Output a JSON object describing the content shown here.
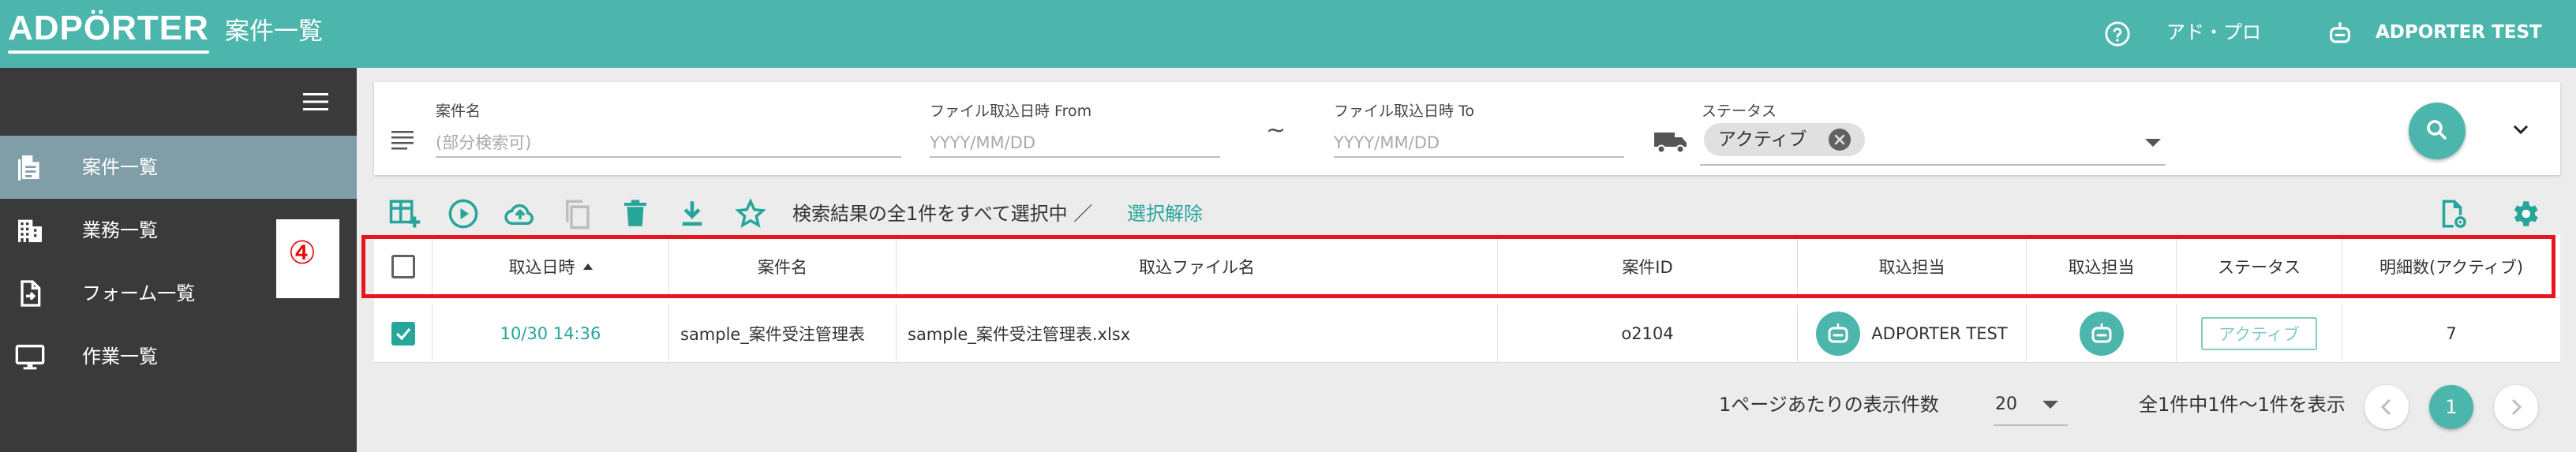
{
  "header": {
    "logo": "ADPÖRTER",
    "title": "案件一覧",
    "user_label": "アド・プロ",
    "account_name": "ADPORTER TEST"
  },
  "sidebar": {
    "items": [
      {
        "label": "案件一覧",
        "icon": "document-icon",
        "active": true
      },
      {
        "label": "業務一覧",
        "icon": "building-icon",
        "active": false
      },
      {
        "label": "フォーム一覧",
        "icon": "form-import-icon",
        "active": false
      },
      {
        "label": "作業一覧",
        "icon": "monitor-icon",
        "active": false
      }
    ],
    "callout": "④"
  },
  "filter": {
    "case_name_label": "案件名",
    "case_name_placeholder": "(部分検索可)",
    "from_label": "ファイル取込日時 From",
    "from_placeholder": "YYYY/MM/DD",
    "tilde": "~",
    "to_label": "ファイル取込日時 To",
    "to_placeholder": "YYYY/MM/DD",
    "status_label": "ステータス",
    "status_chip": "アクティブ"
  },
  "toolbar": {
    "selection_text": "検索結果の全1件をすべて選択中 ／",
    "clear_selection": "選択解除"
  },
  "table": {
    "columns": [
      "取込日時",
      "案件名",
      "取込ファイル名",
      "案件ID",
      "取込担当",
      "取込担当",
      "ステータス",
      "明細数(アクティブ)"
    ],
    "rows": [
      {
        "date": "10/30 14:36",
        "case_name": "sample_案件受注管理表",
        "file_name": "sample_案件受注管理表.xlsx",
        "case_id": "o2104",
        "owner": "ADPORTER TEST",
        "status": "アクティブ",
        "count": "7"
      }
    ]
  },
  "pagination": {
    "per_page_label": "1ページあたりの表示件数",
    "per_page_value": "20",
    "range_text": "全1件中1件〜1件を表示",
    "current_page": "1"
  },
  "colors": {
    "primary": "#4db6ac",
    "sidebar": "#3a3a3a",
    "highlight": "#e8141e"
  }
}
